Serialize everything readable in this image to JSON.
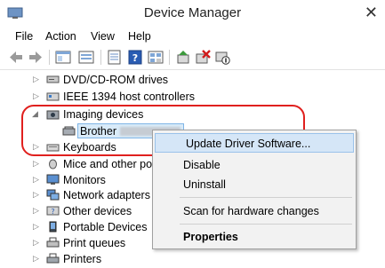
{
  "window": {
    "title": "Device Manager"
  },
  "menu": [
    "File",
    "Action",
    "View",
    "Help"
  ],
  "tree": {
    "items": [
      {
        "label": "DVD/CD-ROM drives",
        "icon": "dvd-drive-icon"
      },
      {
        "label": "IEEE 1394 host controllers",
        "icon": "ieee1394-icon"
      },
      {
        "label": "Imaging devices",
        "icon": "camera-icon"
      },
      {
        "label": "Brother",
        "icon": "scanner-icon"
      },
      {
        "label": "Keyboards",
        "icon": "keyboard-icon"
      },
      {
        "label": "Mice and other po",
        "icon": "mouse-icon"
      },
      {
        "label": "Monitors",
        "icon": "monitor-icon"
      },
      {
        "label": "Network adapters",
        "icon": "network-adapter-icon"
      },
      {
        "label": "Other devices",
        "icon": "other-devices-icon"
      },
      {
        "label": "Portable Devices",
        "icon": "portable-device-icon"
      },
      {
        "label": "Print queues",
        "icon": "print-queue-icon"
      },
      {
        "label": "Printers",
        "icon": "printer-icon"
      }
    ]
  },
  "context_menu": {
    "items": [
      {
        "label": "Update Driver Software..."
      },
      {
        "label": "Disable"
      },
      {
        "label": "Uninstall"
      },
      {
        "label": "Scan for hardware changes"
      },
      {
        "label": "Properties"
      }
    ]
  },
  "colors": {
    "highlight_oval": "#e0201e",
    "menu_hover": "#d5e6f7",
    "selection": "#d9ebf9"
  }
}
